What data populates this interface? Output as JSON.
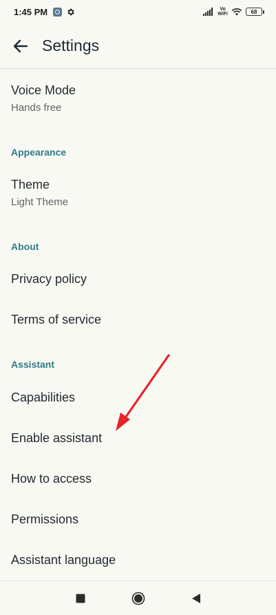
{
  "status_bar": {
    "time": "1:45 PM",
    "volte_top": "Vo",
    "volte_bottom": "WiFi",
    "battery": "68"
  },
  "app_bar": {
    "title": "Settings"
  },
  "voice_mode": {
    "title": "Voice Mode",
    "value": "Hands free"
  },
  "sections": {
    "appearance": "Appearance",
    "about": "About",
    "assistant": "Assistant"
  },
  "theme": {
    "title": "Theme",
    "value": "Light Theme"
  },
  "about_items": {
    "privacy": "Privacy policy",
    "terms": "Terms of service"
  },
  "assistant_items": {
    "capabilities": "Capabilities",
    "enable": "Enable assistant",
    "how_to_access": "How to access",
    "permissions": "Permissions",
    "language": "Assistant language"
  },
  "colors": {
    "background": "#f9f9f4",
    "section_header": "#2f7b86",
    "annotation_arrow": "#e5252a"
  },
  "icons": {
    "back": "arrow-left-icon",
    "gear": "gear-icon",
    "signal": "signal-bars-icon",
    "wifi": "wifi-icon",
    "recents": "square-icon",
    "home": "circle-icon",
    "nav_back": "triangle-back-icon"
  }
}
